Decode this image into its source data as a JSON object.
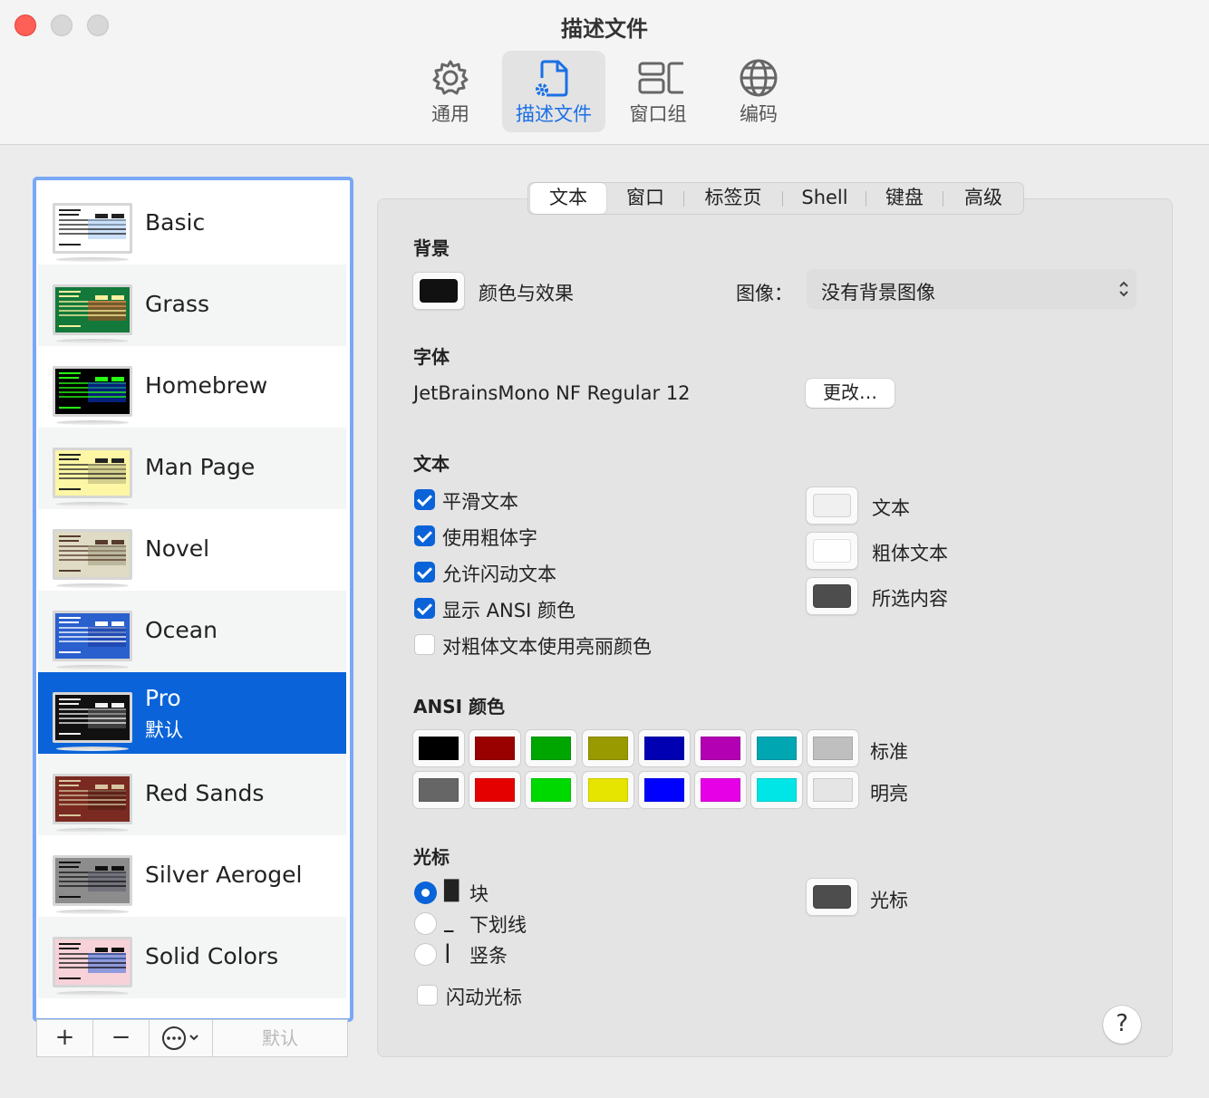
{
  "window": {
    "title": "描述文件"
  },
  "toolbar": [
    {
      "label": "通用",
      "icon": "gear-icon"
    },
    {
      "label": "描述文件",
      "icon": "profile-document-icon",
      "selected": true
    },
    {
      "label": "窗口组",
      "icon": "window-group-icon"
    },
    {
      "label": "编码",
      "icon": "globe-icon"
    }
  ],
  "profiles": [
    {
      "name": "Basic",
      "bg": "#ffffff",
      "fg": "#222222",
      "hl": "#9fc6f2"
    },
    {
      "name": "Grass",
      "bg": "#12793a",
      "fg": "#ffef9f",
      "hl": "#c0461d"
    },
    {
      "name": "Homebrew",
      "bg": "#000000",
      "fg": "#28fe14",
      "hl": "#0b3ae0"
    },
    {
      "name": "Man Page",
      "bg": "#fdf6a5",
      "fg": "#222222",
      "hl": "#b4b17a"
    },
    {
      "name": "Novel",
      "bg": "#dfdbc4",
      "fg": "#573b2c",
      "hl": "#9c9a80"
    },
    {
      "name": "Ocean",
      "bg": "#2a5fce",
      "fg": "#ffffff",
      "hl": "#1a3a9e"
    },
    {
      "name": "Pro",
      "subtitle": "默认",
      "bg": "#111111",
      "fg": "#f2f2f2",
      "hl": "#666666",
      "selected": true
    },
    {
      "name": "Red Sands",
      "bg": "#7a2a20",
      "fg": "#d6c5a0",
      "hl": "#4a1c14"
    },
    {
      "name": "Silver Aerogel",
      "bg": "#8c8c8c",
      "fg": "#111111",
      "hl": "#5e5e70"
    },
    {
      "name": "Solid Colors",
      "bg": "#f7d2d8",
      "fg": "#111111",
      "hl": "#3b6ce0"
    }
  ],
  "list_actions": {
    "add": "+",
    "remove": "−",
    "default": "默认"
  },
  "tabs": [
    "文本",
    "窗口",
    "标签页",
    "Shell",
    "键盘",
    "高级"
  ],
  "background": {
    "section": "背景",
    "color_effects_label": "颜色与效果",
    "color_swatch": "#111111",
    "image_label": "图像：",
    "image_value": "没有背景图像"
  },
  "font": {
    "section": "字体",
    "value": "JetBrainsMono NF Regular 12",
    "change_button": "更改…"
  },
  "text": {
    "section": "文本",
    "options": [
      {
        "label": "平滑文本",
        "checked": true
      },
      {
        "label": "使用粗体字",
        "checked": true
      },
      {
        "label": "允许闪动文本",
        "checked": true
      },
      {
        "label": "显示 ANSI 颜色",
        "checked": true
      },
      {
        "label": "对粗体文本使用亮丽颜色",
        "checked": false
      }
    ],
    "colors": [
      {
        "label": "文本",
        "color": "#f0f0f0"
      },
      {
        "label": "粗体文本",
        "color": "#ffffff"
      },
      {
        "label": "所选内容",
        "color": "#4d4d4d"
      }
    ]
  },
  "ansi": {
    "section": "ANSI 颜色",
    "normal_label": "标准",
    "bright_label": "明亮",
    "normal": [
      "#000000",
      "#990000",
      "#00a600",
      "#999900",
      "#0000b2",
      "#b200b2",
      "#00a6b2",
      "#bfbfbf"
    ],
    "bright": [
      "#666666",
      "#e50000",
      "#00d900",
      "#e5e500",
      "#0000ff",
      "#e500e5",
      "#00e5e5",
      "#e5e5e5"
    ]
  },
  "cursor": {
    "section": "光标",
    "styles": [
      {
        "glyph": "█",
        "label": "块",
        "selected": true
      },
      {
        "glyph": "_",
        "label": "下划线",
        "selected": false
      },
      {
        "glyph": "|",
        "label": "竖条",
        "selected": false
      }
    ],
    "blink_label": "闪动光标",
    "blink": false,
    "color_label": "光标",
    "color": "#4d4d4d"
  },
  "help": "?"
}
